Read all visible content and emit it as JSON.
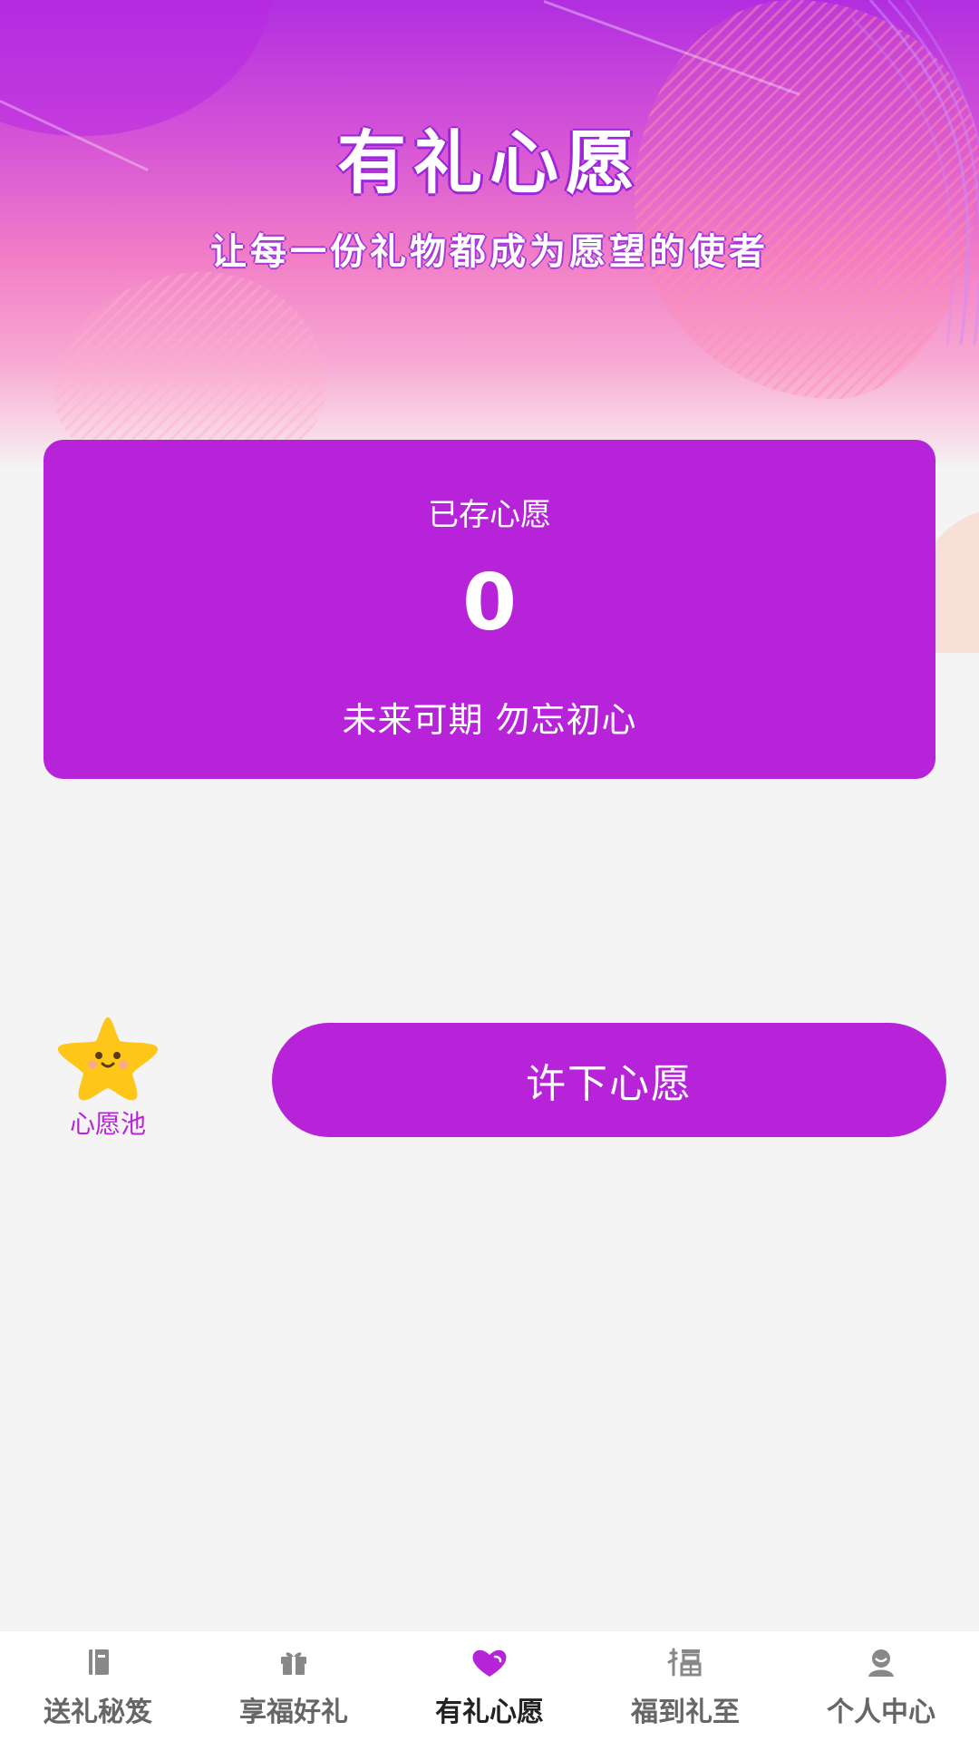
{
  "header": {
    "title": "有礼心愿",
    "subtitle": "让每一份礼物都成为愿望的使者"
  },
  "wish_card": {
    "label": "已存心愿",
    "count": "0",
    "motto": "未来可期 勿忘初心"
  },
  "wish_pool": {
    "label": "心愿池",
    "icon": "smiling-star-icon"
  },
  "make_wish_button": {
    "label": "许下心愿"
  },
  "tabbar": {
    "active_index": 2,
    "items": [
      {
        "label": "送礼秘笈",
        "icon": "book-icon"
      },
      {
        "label": "享福好礼",
        "icon": "gift-icon"
      },
      {
        "label": "有礼心愿",
        "icon": "heart-icon"
      },
      {
        "label": "福到礼至",
        "icon": "fu-character-icon"
      },
      {
        "label": "个人中心",
        "icon": "user-icon"
      }
    ]
  },
  "colors": {
    "accent": "#b723d9",
    "inactive": "#666666",
    "active": "#222222",
    "star": "#ffc61a"
  }
}
